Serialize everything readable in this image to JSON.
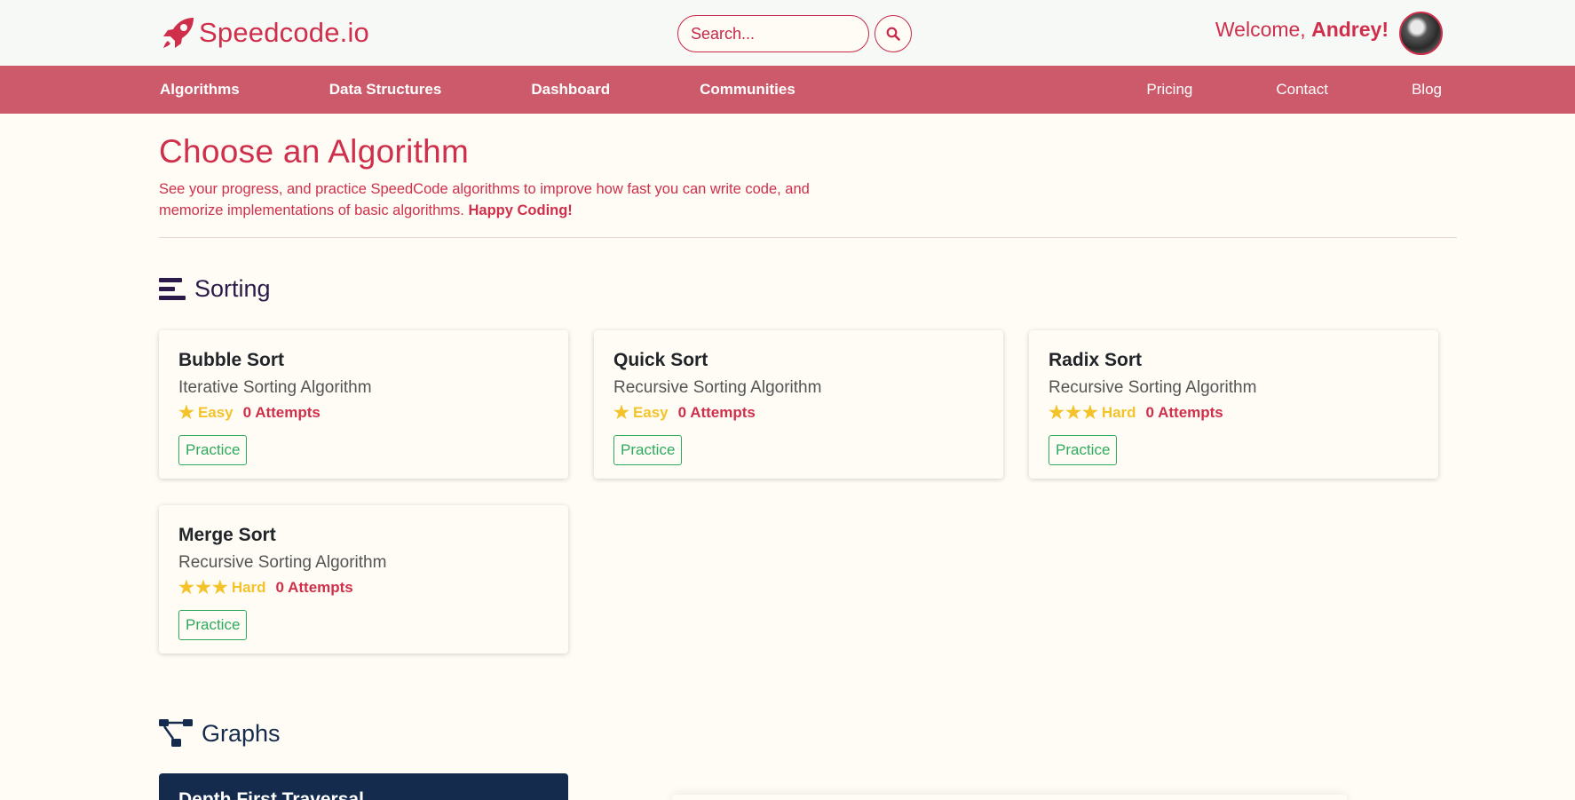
{
  "header": {
    "logo_text": "Speedcode.io",
    "search_placeholder": "Search...",
    "welcome_prefix": "Welcome, ",
    "welcome_name": "Andrey!"
  },
  "nav": {
    "left": [
      "Algorithms",
      "Data Structures",
      "Dashboard",
      "Communities"
    ],
    "right": [
      "Pricing",
      "Contact",
      "Blog"
    ]
  },
  "main": {
    "title": "Choose an Algorithm",
    "intro": "See your progress, and practice SpeedCode algorithms to improve how fast you can write code, and memorize implementations of basic algorithms.",
    "intro_bold": "Happy Coding!"
  },
  "sections": [
    {
      "title": "Sorting",
      "icon": "bars-icon",
      "cards": [
        {
          "title": "Bubble Sort",
          "subtitle": "Iterative Sorting Algorithm",
          "difficulty": "Easy",
          "stars": 1,
          "attempts": "0 Attempts",
          "button": "Practice"
        },
        {
          "title": "Quick Sort",
          "subtitle": "Recursive Sorting Algorithm",
          "difficulty": "Easy",
          "stars": 1,
          "attempts": "0 Attempts",
          "button": "Practice"
        },
        {
          "title": "Radix Sort",
          "subtitle": "Recursive Sorting Algorithm",
          "difficulty": "Hard",
          "stars": 3,
          "attempts": "0 Attempts",
          "button": "Practice"
        },
        {
          "title": "Merge Sort",
          "subtitle": "Recursive Sorting Algorithm",
          "difficulty": "Hard",
          "stars": 3,
          "attempts": "0 Attempts",
          "button": "Practice"
        }
      ]
    },
    {
      "title": "Graphs",
      "icon": "graph-tree-icon",
      "cards": [
        {
          "title": "Depth First Traversal"
        }
      ]
    }
  ],
  "colors": {
    "brand": "#cf2f4b",
    "nav_bg": "#cc5a6b",
    "star": "#f4c32a",
    "practice": "#2eaa5f",
    "sorting_head": "#2c1a4b",
    "graphs_head": "#142b4d"
  }
}
